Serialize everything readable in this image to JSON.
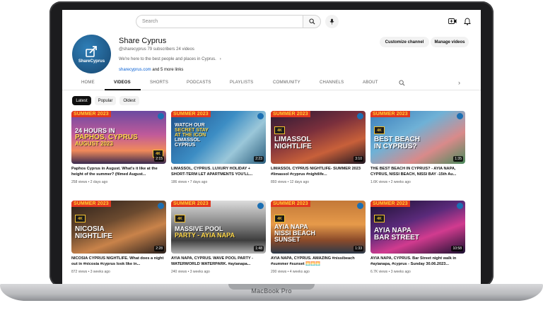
{
  "device": {
    "label": "MacBook Pro"
  },
  "topbar": {
    "search_placeholder": "Search"
  },
  "channel": {
    "avatar_text": "ShareCyprus",
    "name": "Share Cyprus",
    "handle": "@sharecyprus",
    "subscribers": "79 subscribers",
    "videos_count": "24 videos",
    "description": "We're here to the best people and places in Cyprus.",
    "link": "sharecyprus.com",
    "more_links": "and 5 more links",
    "customize_label": "Customize channel",
    "manage_label": "Manage videos"
  },
  "tabs": [
    "HOME",
    "VIDEOS",
    "SHORTS",
    "PODCASTS",
    "PLAYLISTS",
    "COMMUNITY",
    "CHANNELS",
    "ABOUT"
  ],
  "filters": [
    "Latest",
    "Popular",
    "Oldest"
  ],
  "thumb_banner": "SUMMER 2023",
  "thumb_badge": "4K",
  "videos": [
    {
      "headline_a": "24 HOURS IN",
      "headline_b": "PAPHOS, CYPRUS",
      "headline_c": "AUGUST 2023",
      "duration": "2:15",
      "title": "Paphos Cyprus in August. What's it like at the height of the summer? (filmed August...",
      "views": "258 views",
      "age": "2 days ago"
    },
    {
      "headline_a": "WATCH OUR",
      "headline_b": "SECRET STAY",
      "headline_c": "AT THE ICON",
      "headline_d": "LIMASSOL",
      "headline_e": "CYPRUS",
      "duration": "2:23",
      "title": "LIMASSOL, CYPRUS. LUXURY HOLIDAY + SHORT-TERM LET APARTMENTS YOU'LL...",
      "views": "186 views",
      "age": "7 days ago"
    },
    {
      "headline_a": "LIMASSOL",
      "headline_b": "NIGHTLIFE",
      "duration": "3:10",
      "title": "LIMASSOL CYPRUS NIGHTLIFE- SUMMER 2023 #limassol #cyprus #nightlife...",
      "views": "893 views",
      "age": "12 days ago"
    },
    {
      "headline_a": "BEST BEACH",
      "headline_b": "IN CYPRUS?",
      "duration": "1:35",
      "title": "THE BEST BEACH IN CYPRUS? - AYIA NAPA, CYPRUS, NISSI BEACH, NISSI BAY -15th Au...",
      "views": "1.6K views",
      "age": "2 weeks ago"
    },
    {
      "headline_a": "NICOSIA",
      "headline_b": "NIGHTLIFE",
      "duration": "2:28",
      "title": "NICOSIA CYPRUS NIGHTLIFE. What does a night out in #nicosia #cyprus look like in...",
      "views": "872 views",
      "age": "3 weeks ago"
    },
    {
      "headline_a": "MASSIVE POOL",
      "headline_b": "PARTY - AYIA NAPA",
      "duration": "1:48",
      "title": "AYIA NAPA, CYPRUS. WAVE POOL PARTY - WATERWORLD WATERPARK. #ayianapa...",
      "views": "240 views",
      "age": "3 weeks ago"
    },
    {
      "headline_a": "AYIA NAPA",
      "headline_b": "NISSI BEACH",
      "headline_c": "SUNSET",
      "duration": "1:33",
      "title": "AYIA NAPA, CYPRUS. AMAZING #nissibeach #summer #sunset 🌅🌅🌅",
      "views": "200 views",
      "age": "4 weeks ago"
    },
    {
      "headline_a": "AYIA NAPA",
      "headline_b": "BAR STREET",
      "duration": "10:58",
      "title": "AYIA NAPA, CYPRUS. Bar Street night walk in #ayianapa, #cyprus - Sunday 30.06.2023...",
      "views": "6.7K views",
      "age": "3 weeks ago"
    }
  ]
}
